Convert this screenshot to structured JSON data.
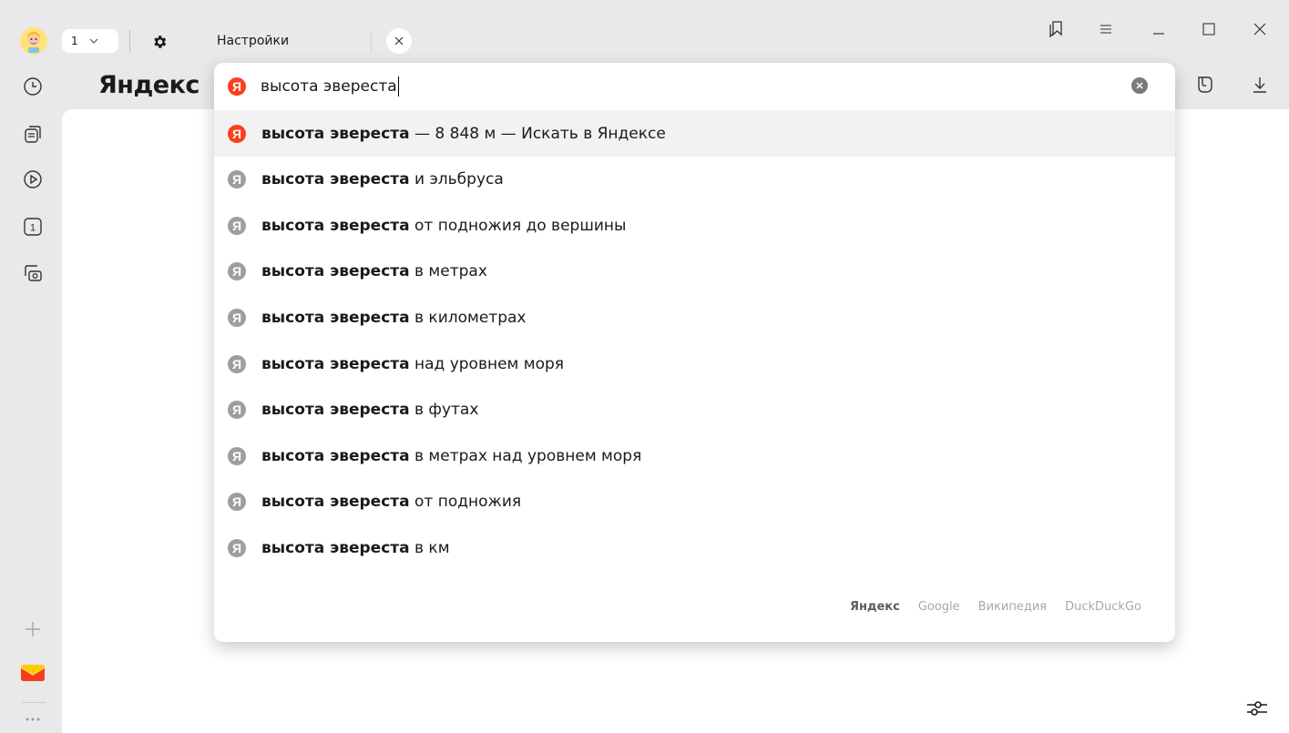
{
  "browser": {
    "tab_count": "1",
    "tab_title": "Настройки",
    "brand": "Яндекс"
  },
  "search": {
    "query": "высота эвереста"
  },
  "suggestions": [
    {
      "bold": "высота эвереста",
      "rest": " — 8 848 м — Искать в Яндексе",
      "icon": "yandex-red-icon",
      "selected": true
    },
    {
      "bold": "высота эвереста",
      "rest": " и эльбруса",
      "icon": "yandex-gray-icon"
    },
    {
      "bold": "высота эвереста",
      "rest": " от подножия до вершины",
      "icon": "yandex-gray-icon"
    },
    {
      "bold": "высота эвереста",
      "rest": " в метрах",
      "icon": "yandex-gray-icon"
    },
    {
      "bold": "высота эвереста",
      "rest": " в километрах",
      "icon": "yandex-gray-icon"
    },
    {
      "bold": "высота эвереста",
      "rest": " над уровнем моря",
      "icon": "yandex-gray-icon"
    },
    {
      "bold": "высота эвереста",
      "rest": " в футах",
      "icon": "yandex-gray-icon"
    },
    {
      "bold": "высота эвереста",
      "rest": " в метрах над уровнем моря",
      "icon": "yandex-gray-icon"
    },
    {
      "bold": "высота эвереста",
      "rest": " от подножия",
      "icon": "yandex-gray-icon"
    },
    {
      "bold": "высота эвереста",
      "rest": " в км",
      "icon": "yandex-gray-icon"
    }
  ],
  "engines": [
    "Яндекс",
    "Google",
    "Википедия",
    "DuckDuckGo"
  ],
  "engine_active": "Яндекс",
  "logo_letter": "Я",
  "colors": {
    "yandex_red": "#fc3f1d",
    "suggest_gray": "#9e9e9e",
    "selected_row": "#f2f2f3"
  }
}
